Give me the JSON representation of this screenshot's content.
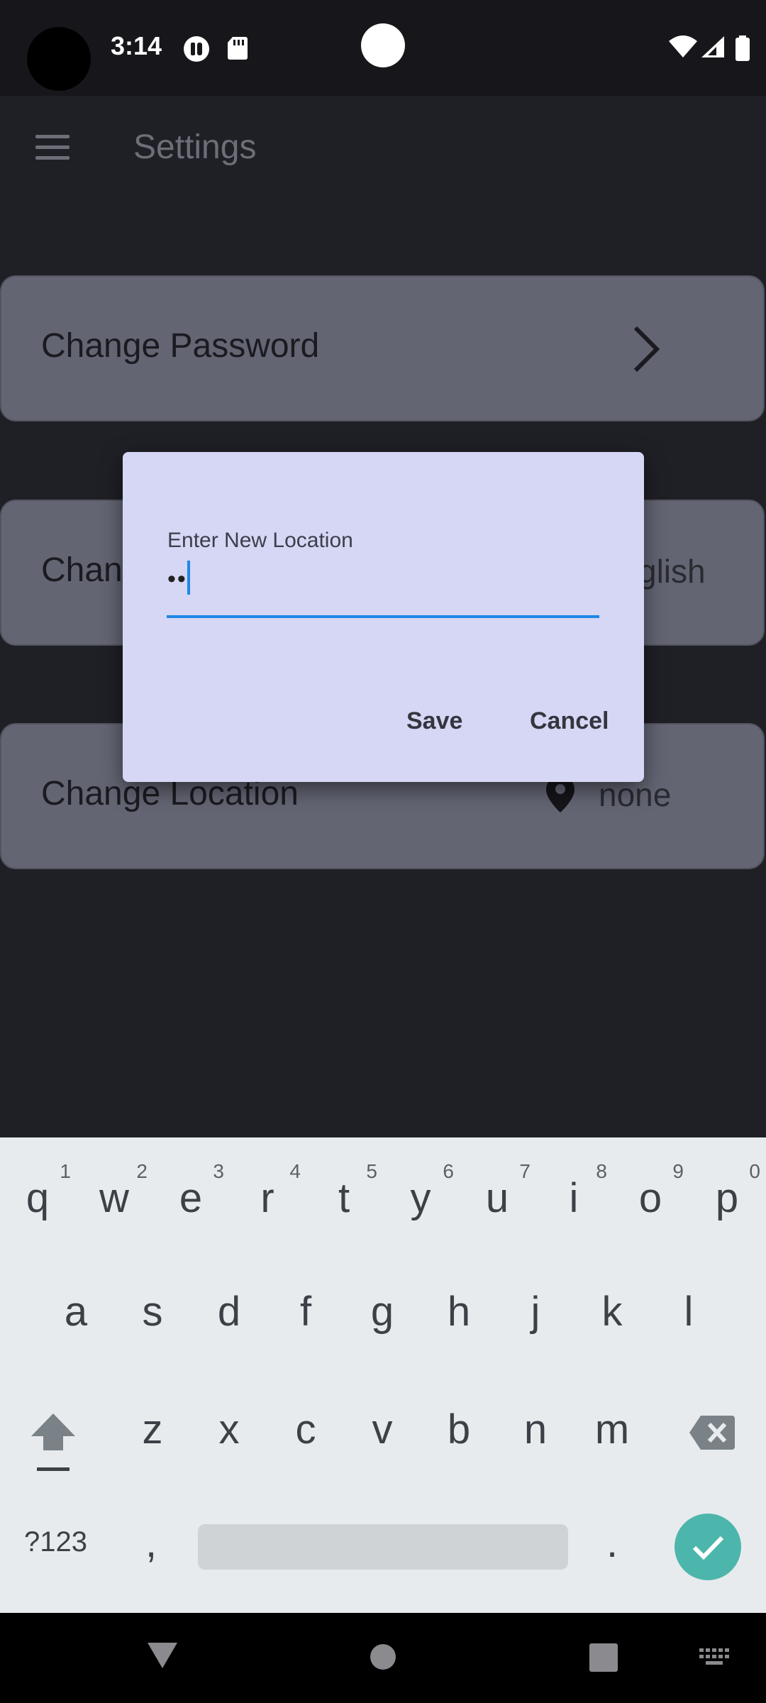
{
  "status_bar": {
    "time": "3:14"
  },
  "app_bar": {
    "title": "Settings"
  },
  "settings": {
    "change_password": {
      "label": "Change Password"
    },
    "change_language": {
      "label_visible": "Chan",
      "value_visible": "glish"
    },
    "change_location": {
      "label": "Change Location",
      "value": "none"
    }
  },
  "dialog": {
    "field_label": "Enter New Location",
    "field_value": "••",
    "save_label": "Save",
    "cancel_label": "Cancel"
  },
  "keyboard": {
    "row1": [
      {
        "key": "q",
        "hint": "1"
      },
      {
        "key": "w",
        "hint": "2"
      },
      {
        "key": "e",
        "hint": "3"
      },
      {
        "key": "r",
        "hint": "4"
      },
      {
        "key": "t",
        "hint": "5"
      },
      {
        "key": "y",
        "hint": "6"
      },
      {
        "key": "u",
        "hint": "7"
      },
      {
        "key": "i",
        "hint": "8"
      },
      {
        "key": "o",
        "hint": "9"
      },
      {
        "key": "p",
        "hint": "0"
      }
    ],
    "row2": [
      "a",
      "s",
      "d",
      "f",
      "g",
      "h",
      "j",
      "k",
      "l"
    ],
    "row3": [
      "z",
      "x",
      "c",
      "v",
      "b",
      "n",
      "m"
    ],
    "symbols_label": "?123",
    "comma": ",",
    "period": "."
  },
  "colors": {
    "accent": "#1e88e5",
    "dialog_bg": "#d5d7f5",
    "enter_key": "#4db6ac"
  }
}
